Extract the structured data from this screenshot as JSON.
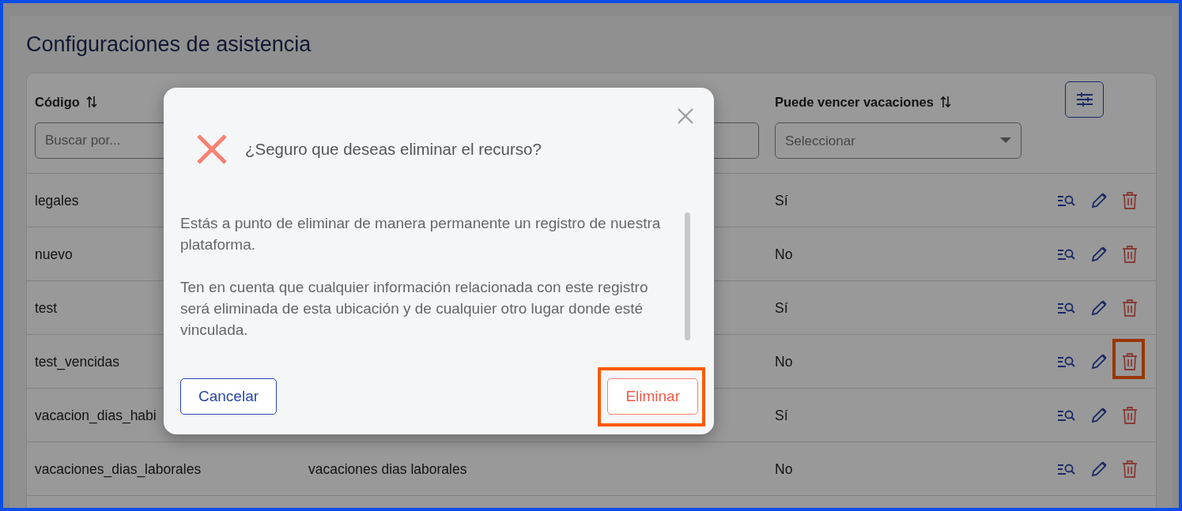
{
  "page": {
    "title": "Configuraciones de asistencia"
  },
  "table": {
    "columns": [
      {
        "label": "Código",
        "sortable": true,
        "filter": {
          "kind": "text",
          "placeholder": "Buscar por..."
        }
      },
      {
        "filter": {
          "kind": "text"
        }
      },
      {
        "label": "Puede vencer vacaciones",
        "sortable": true,
        "filter": {
          "kind": "select",
          "placeholder": "Seleccionar"
        }
      }
    ],
    "rows": [
      {
        "codigo": "legales",
        "puede_vencer_vacaciones": "Sí",
        "delete_highlighted": false
      },
      {
        "codigo": "nuevo",
        "puede_vencer_vacaciones": "No",
        "delete_highlighted": false
      },
      {
        "codigo": "test",
        "puede_vencer_vacaciones": "Sí",
        "delete_highlighted": false
      },
      {
        "codigo": "test_vencidas",
        "puede_vencer_vacaciones": "No",
        "delete_highlighted": true
      },
      {
        "codigo": "vacacion_dias_habi",
        "puede_vencer_vacaciones": "Sí",
        "delete_highlighted": false
      },
      {
        "codigo": "vacaciones_dias_laborales",
        "column_2": "vacaciones dias laborales",
        "puede_vencer_vacaciones": "No",
        "delete_highlighted": false
      }
    ]
  },
  "dialog": {
    "title": "¿Seguro que deseas eliminar el recurso?",
    "paragraphs": [
      "Estás a punto de eliminar de manera permanente un registro de nuestra plataforma.",
      "Ten en cuenta que cualquier información relacionada con este registro será eliminada de esta ubicación y de cualquier otro lugar donde esté vinculada."
    ],
    "buttons": [
      {
        "label": "Cancelar",
        "kind": "secondary",
        "highlighted": false
      },
      {
        "label": "Eliminar",
        "kind": "danger",
        "highlighted": true
      }
    ]
  }
}
